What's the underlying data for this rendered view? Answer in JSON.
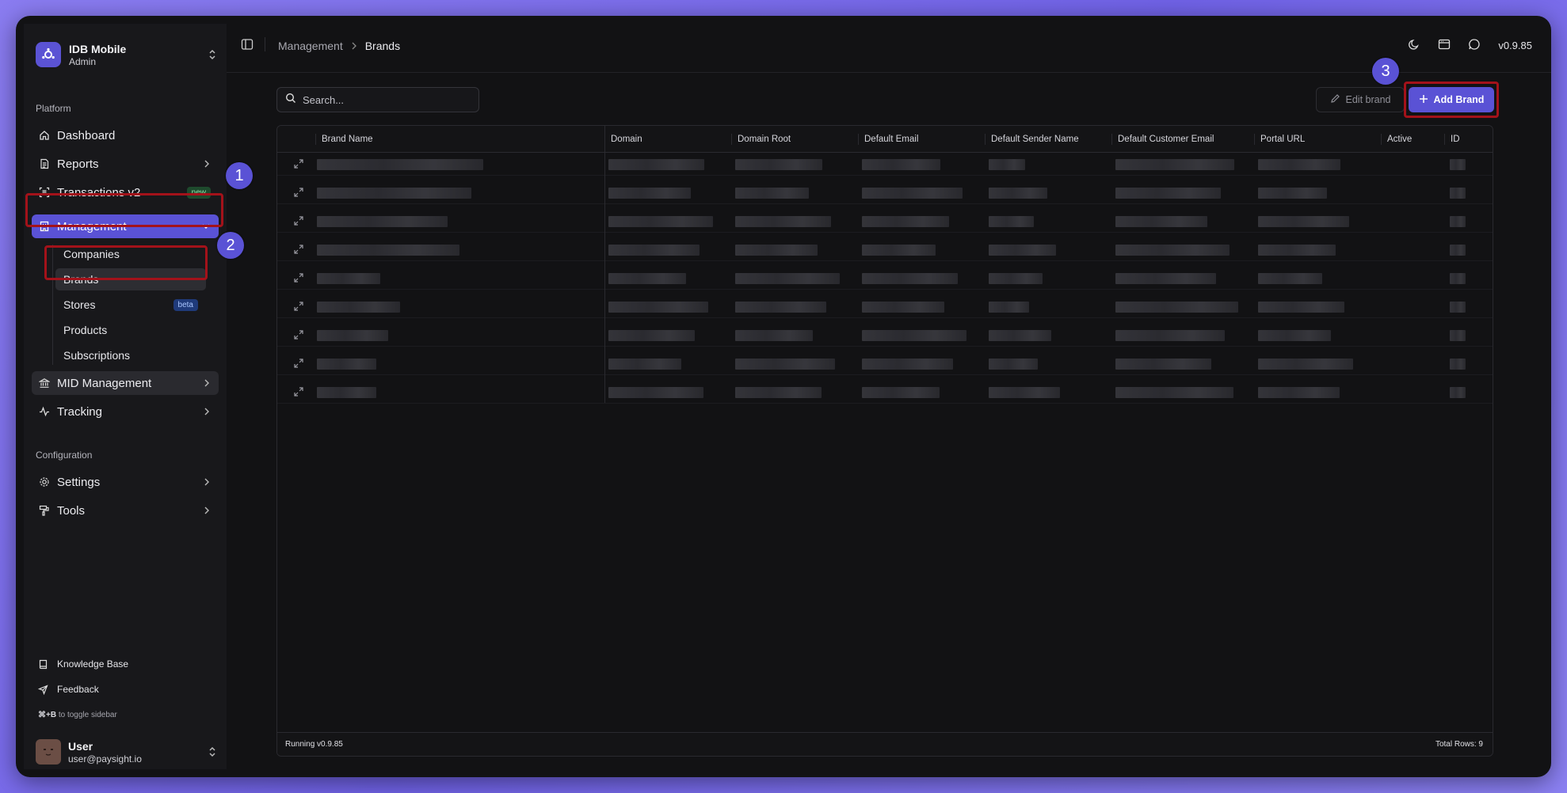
{
  "app": {
    "name": "IDB Mobile",
    "role": "Admin"
  },
  "sidebar": {
    "section_platform": "Platform",
    "section_config": "Configuration",
    "items": [
      {
        "label": "Dashboard"
      },
      {
        "label": "Reports"
      },
      {
        "label": "Transactions v2",
        "badge": "new"
      },
      {
        "label": "Management"
      },
      {
        "label": "MID Management"
      },
      {
        "label": "Tracking"
      },
      {
        "label": "Settings"
      },
      {
        "label": "Tools"
      }
    ],
    "management_sub": [
      {
        "label": "Companies"
      },
      {
        "label": "Brands"
      },
      {
        "label": "Stores",
        "badge": "beta"
      },
      {
        "label": "Products"
      },
      {
        "label": "Subscriptions"
      }
    ],
    "footer": [
      {
        "label": "Knowledge Base"
      },
      {
        "label": "Feedback"
      }
    ],
    "hint_key": "⌘+B",
    "hint_text": " to toggle sidebar",
    "user": {
      "name": "User",
      "email": "user@paysight.io"
    }
  },
  "header": {
    "breadcrumb": [
      "Management",
      "Brands"
    ],
    "version": "v0.9.85"
  },
  "toolbar": {
    "search_placeholder": "Search...",
    "edit_label": "Edit brand",
    "add_label": "Add Brand"
  },
  "table": {
    "columns": [
      "Brand Name",
      "Domain",
      "Domain Root",
      "Default Email",
      "Default Sender Name",
      "Default Customer Email",
      "Portal URL",
      "Active",
      "ID"
    ],
    "row_count": 9,
    "footer_left": "Running v0.9.85",
    "footer_right": "Total Rows: 9"
  },
  "annotations": [
    "1",
    "2",
    "3"
  ],
  "colors": {
    "accent": "#5a52d5",
    "highlight": "#a3121a",
    "background": "#121214"
  }
}
